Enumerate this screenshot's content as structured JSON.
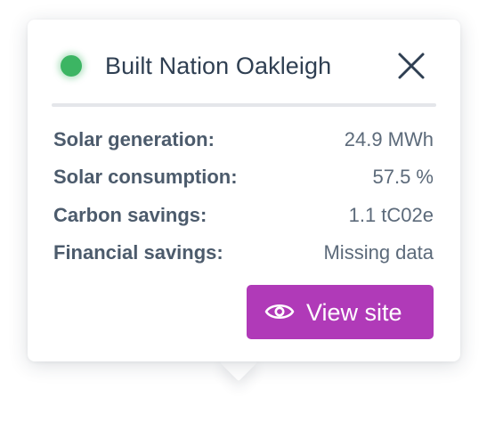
{
  "popup": {
    "title": "Built Nation Oakleigh",
    "status_color": "#3cb563",
    "status_icon": "status-dot-icon",
    "close_icon": "close-icon",
    "stats": [
      {
        "label": "Solar generation:",
        "value": "24.9 MWh"
      },
      {
        "label": "Solar consumption:",
        "value": "57.5 %"
      },
      {
        "label": "Carbon savings:",
        "value": "1.1 tC02e"
      },
      {
        "label": "Financial savings:",
        "value": "Missing data"
      }
    ],
    "view_button": {
      "label": "View site",
      "icon": "eye-icon",
      "color": "#b03ab8"
    }
  }
}
